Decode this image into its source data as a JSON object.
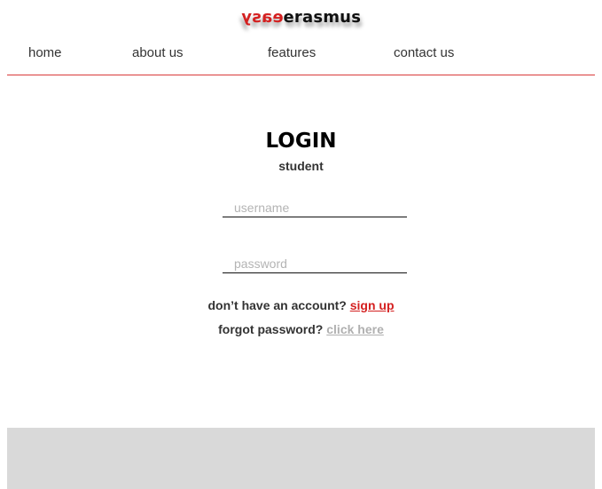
{
  "brand": {
    "mirrored_part": "easy",
    "word_part": "erasmus",
    "accent_color": "#d42020"
  },
  "nav": {
    "items": [
      {
        "label": "home"
      },
      {
        "label": "about us"
      },
      {
        "label": "features"
      },
      {
        "label": "contact us"
      }
    ]
  },
  "login": {
    "title": "LOGIN",
    "subtitle": "student",
    "username_placeholder": "username",
    "password_placeholder": "password",
    "signup_prompt": "don’t have an account? ",
    "signup_link": "sign up",
    "forgot_prompt": "forgot password? ",
    "forgot_link": "click here"
  },
  "colors": {
    "divider": "#d93a3a",
    "footer_bg": "#d9d9d9"
  }
}
